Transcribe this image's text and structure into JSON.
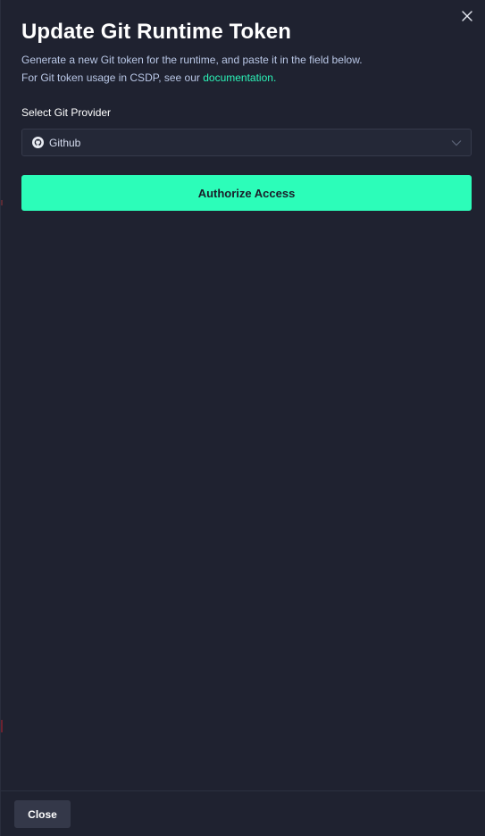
{
  "dialog": {
    "title": "Update Git Runtime Token",
    "description_line1": "Generate a new Git token for the runtime, and paste it in the field below.",
    "description_line2_prefix": "For Git token usage in CSDP, see our ",
    "description_link": "documentation.",
    "close_icon": "close-icon"
  },
  "provider": {
    "label": "Select Git Provider",
    "selected": "Github",
    "icon": "github-icon",
    "chevron_icon": "chevron-down-icon"
  },
  "actions": {
    "authorize_label": "Authorize Access",
    "close_label": "Close"
  },
  "colors": {
    "background": "#1f2230",
    "accent": "#2cfdb9",
    "link": "#2cf5b9",
    "description": "#b9c7e6"
  }
}
